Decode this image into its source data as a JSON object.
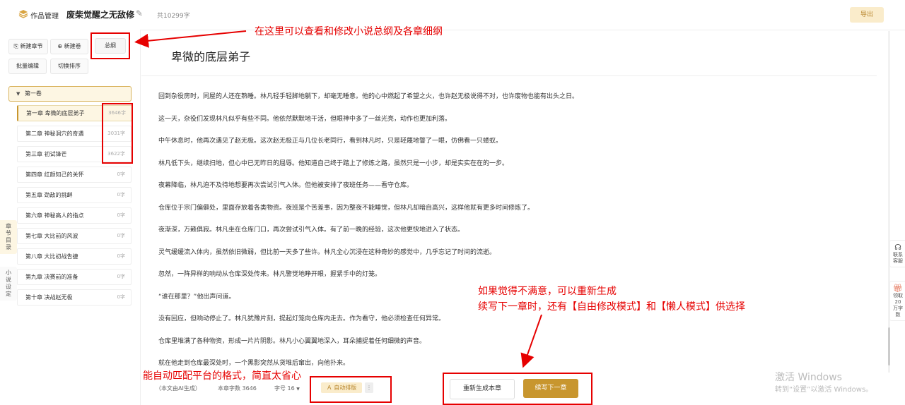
{
  "header": {
    "app_name": "作品管理",
    "novel_title": "废柴觉醒之无敌修炼",
    "word_count": "共10299字",
    "export_label": "导出"
  },
  "sidebar": {
    "buttons": {
      "new_chapter": "新建章节",
      "new_volume": "新建卷",
      "outline": "总纲",
      "batch_edit": "批量编辑",
      "toggle_sort": "切换排序"
    },
    "volume": "第一卷",
    "chapters": [
      {
        "label": "第一章 卑微的底层弟子",
        "count": "3646字"
      },
      {
        "label": "第二章 神秘洞穴的奇遇",
        "count": "3031字"
      },
      {
        "label": "第三章 初试锋芒",
        "count": "3622字"
      },
      {
        "label": "第四章 红颜知己的关怀",
        "count": "0字"
      },
      {
        "label": "第五章 劲敌的挑衅",
        "count": "0字"
      },
      {
        "label": "第六章 神秘高人的指点",
        "count": "0字"
      },
      {
        "label": "第七章 大比前的风波",
        "count": "0字"
      },
      {
        "label": "第八章 大比初战告捷",
        "count": "0字"
      },
      {
        "label": "第九章 决赛前的准备",
        "count": "0字"
      },
      {
        "label": "第十章 决战赵无极",
        "count": "0字"
      }
    ],
    "tab_catalog": "章节目录",
    "tab_settings": "小说设定"
  },
  "editor": {
    "chapter_title": "卑微的底层弟子",
    "paragraphs": [
      "回到杂役房时，同屋的人还在熟睡。林凡轻手轻脚地躺下，却毫无睡意。他的心中燃起了希望之火，也许赵无极说得不对，也许废物也能有出头之日。",
      "这一天，杂役们发现林凡似乎有些不同。他依然默默地干活，但眼神中多了一丝光亮，动作也更加利落。",
      "中午休息时，他再次遇见了赵无极。这次赵无极正与几位长老同行，看到林凡时，只是轻蔑地瞥了一眼，仿佛看一只蝼蚁。",
      "林凡低下头，继续扫地，但心中已无昨日的屈辱。他知道自己终于踏上了修炼之路，虽然只是一小步，却是实实在在的一步。",
      "夜幕降临，林凡迫不及待地想要再次尝试引气入体。但他被安排了夜班任务——看守仓库。",
      "仓库位于宗门偏僻处，里面存放着各类物资。夜班是个苦差事，因为整夜不能睡觉，但林凡却暗自高兴，这样他就有更多时间修炼了。",
      "夜渐深，万籁俱寂。林凡坐在仓库门口，再次尝试引气入体。有了前一晚的经验，这次他更快地进入了状态。",
      "灵气缓缓流入体内，虽然依旧微弱，但比前一天多了些许。林凡全心沉浸在这种奇妙的感觉中，几乎忘记了时间的流逝。",
      "忽然，一阵异样的响动从仓库深处传来。林凡警觉地睁开眼，握紧手中的灯笼。",
      "“谁在那里？”他出声问道。",
      "没有回应，但响动停止了。林凡犹豫片刻，提起灯笼向仓库内走去。作为看守，他必须检查任何异常。",
      "仓库里堆满了各种物资，形成一片片阴影。林凡小心翼翼地深入，耳朵捕捉着任何细微的声音。",
      "就在他走到仓库最深处时，一个黑影突然从货堆后窜出，向他扑来。"
    ]
  },
  "footer": {
    "ai_note": "（本文由AI生成）",
    "chapter_words": "本章字数 3646",
    "font_size": "字号 16",
    "auto_format": "自动排版",
    "more": "⋮",
    "regenerate": "重新生成本章",
    "continue": "续写下一章"
  },
  "float_buttons": {
    "contact": "联系客服",
    "claim": "领取20万字数"
  },
  "watermark": {
    "line1": "激活 Windows",
    "line2": "转到“设置”以激活 Windows。"
  },
  "annotations": {
    "outline_note": "在这里可以查看和修改小说总纲及各章细纲",
    "regen_note_1": "如果觉得不满意，可以重新生成",
    "regen_note_2": "续写下一章时，还有【自由修改模式】和【懒人模式】供选择",
    "format_note": "能自动匹配平台的格式，简直太省心"
  },
  "colors": {
    "accent": "#c8962e",
    "accent_light": "#faeccb",
    "annotation": "#e60000"
  }
}
